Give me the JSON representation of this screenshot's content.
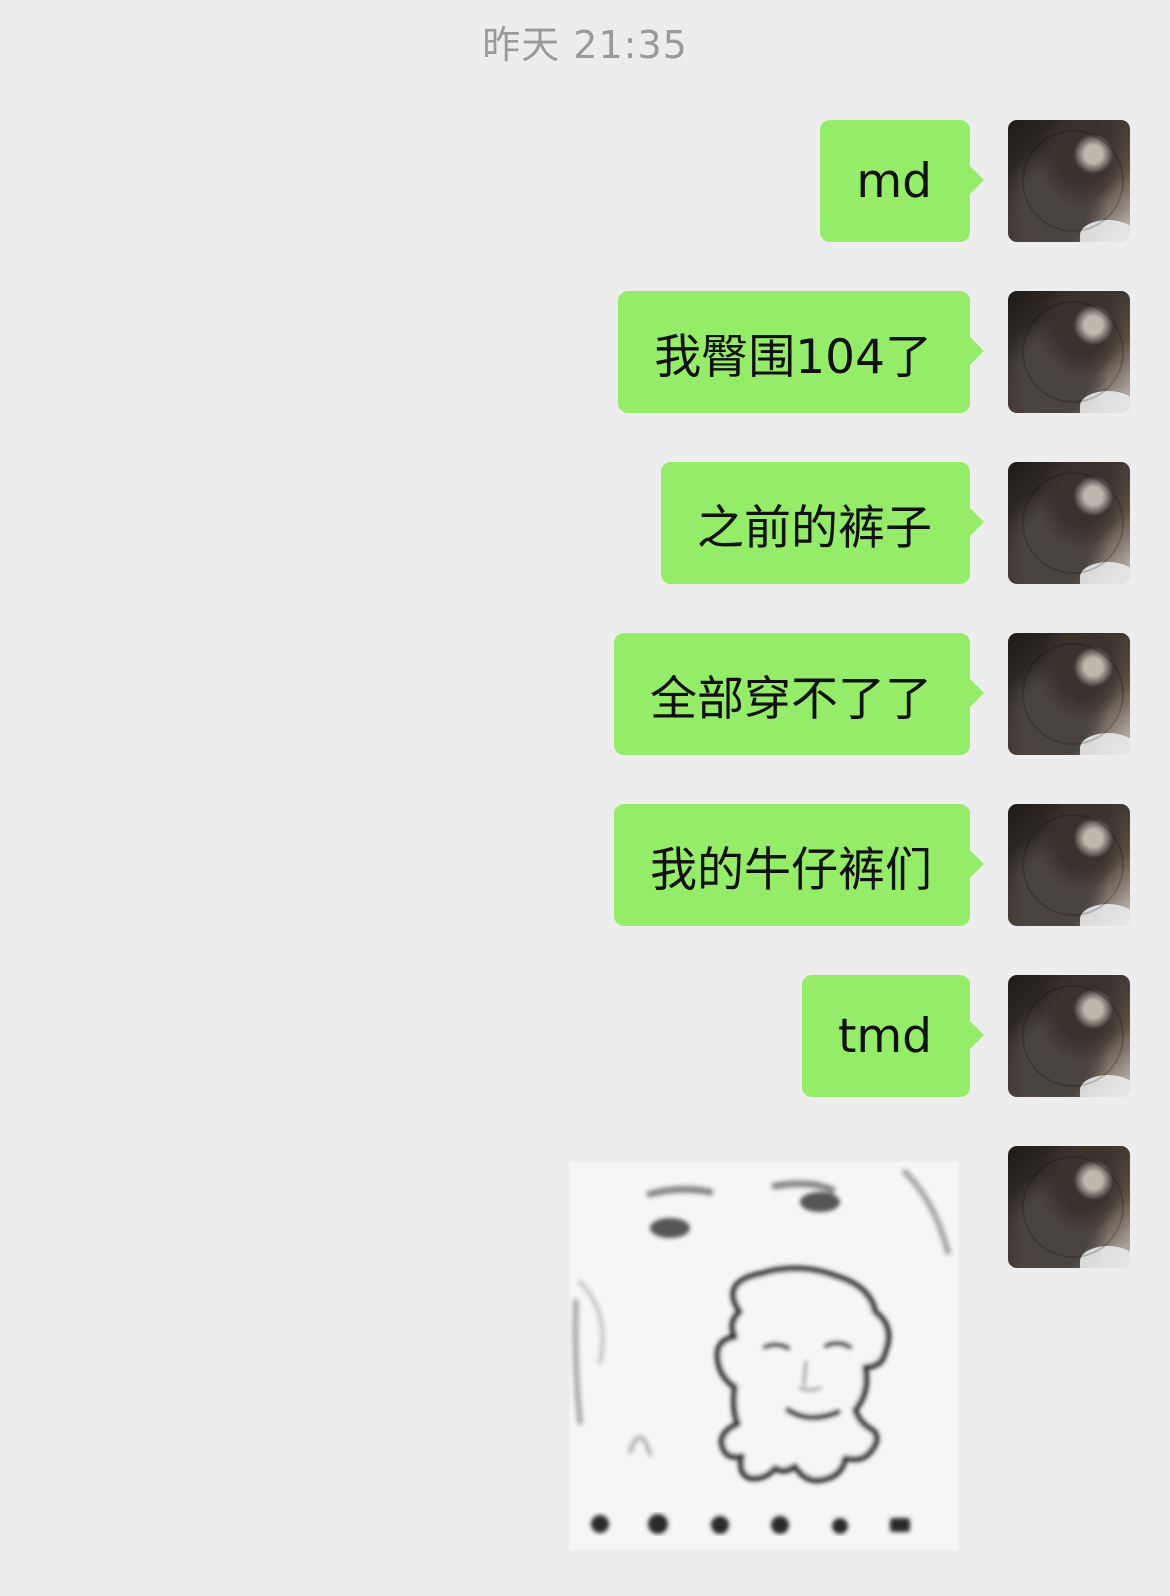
{
  "chat": {
    "timestamp": "昨天 21:35",
    "messages": [
      {
        "text": "md"
      },
      {
        "text": "我臀围104了"
      },
      {
        "text": "之前的裤子"
      },
      {
        "text": "全部穿不了了"
      },
      {
        "text": "我的牛仔裤们"
      },
      {
        "text": "tmd"
      }
    ],
    "sticker": {
      "type": "meme-sticker"
    }
  },
  "colors": {
    "background": "#ededed",
    "bubble": "#95ec69",
    "timestamp": "#9a9a9a"
  }
}
